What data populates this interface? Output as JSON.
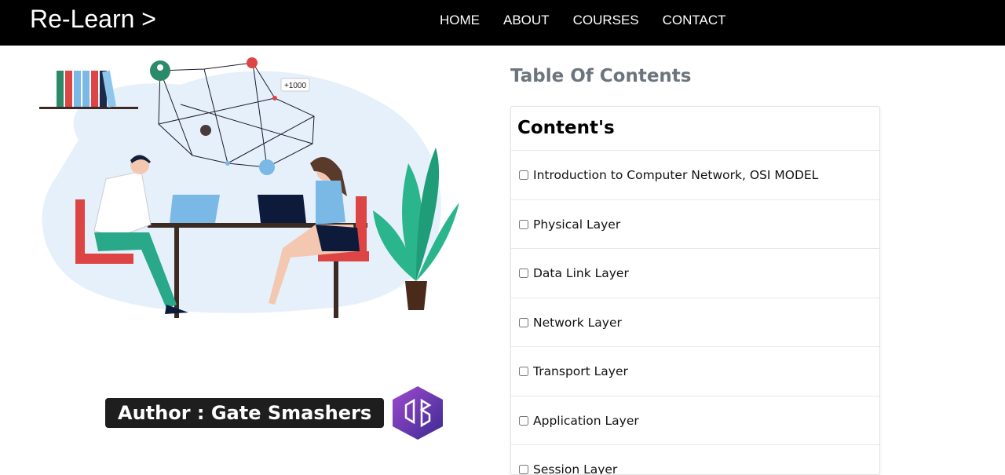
{
  "nav": {
    "brand": "Re-Learn >",
    "links": [
      "HOME",
      "ABOUT",
      "COURSES",
      "CONTACT"
    ]
  },
  "illustration": {
    "badge_text": "+1000"
  },
  "author": {
    "label": "Author : Gate Smashers"
  },
  "toc": {
    "heading": "Table Of Contents",
    "card_title": "Content's",
    "items": [
      {
        "label": "Introduction to Computer Network, OSI MODEL",
        "checked": false
      },
      {
        "label": "Physical Layer",
        "checked": false
      },
      {
        "label": "Data Link Layer",
        "checked": false
      },
      {
        "label": "Network Layer",
        "checked": false
      },
      {
        "label": "Transport Layer",
        "checked": false
      },
      {
        "label": "Application Layer",
        "checked": false
      },
      {
        "label": "Session Layer",
        "checked": false
      }
    ]
  },
  "colors": {
    "navbar_bg": "#000000",
    "heading_gray": "#6c757d",
    "author_bg": "#1e1e1e",
    "logo_purple": "#7b3fc4",
    "plant_green": "#2bb58d"
  }
}
